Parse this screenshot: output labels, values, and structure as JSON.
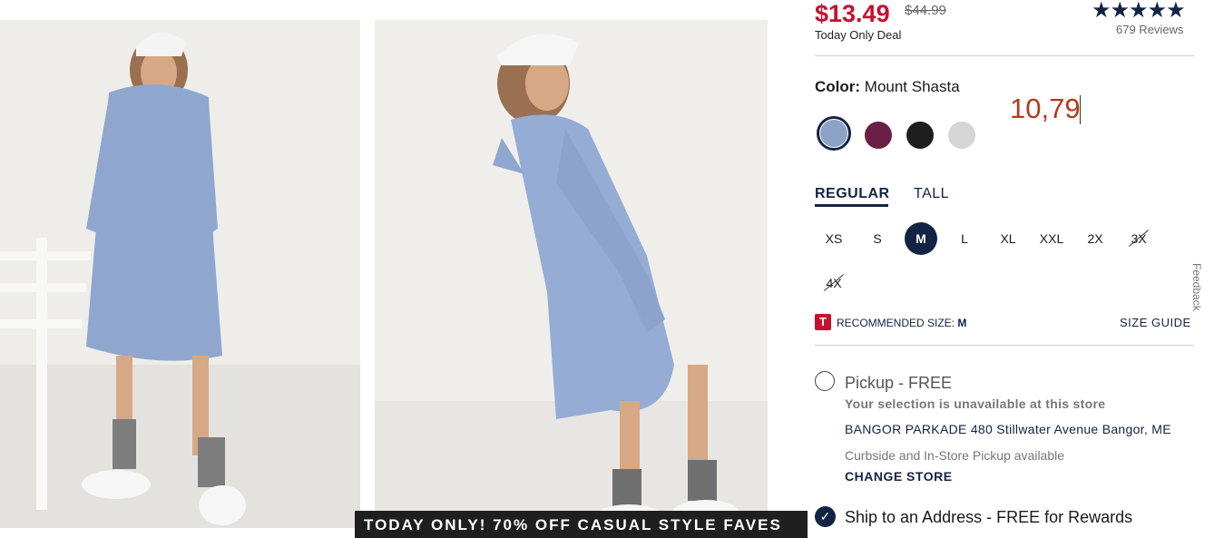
{
  "product": {
    "price": "$13.49",
    "original_price": "$44.99",
    "deal_label": "Today Only Deal",
    "rating_stars": "★★★★★",
    "rating_value": 4.5,
    "reviews": "679 Reviews"
  },
  "color": {
    "label": "Color:",
    "value": "Mount Shasta",
    "swatches": [
      {
        "name": "Mount Shasta",
        "hex": "#8da3c6",
        "selected": true
      },
      {
        "name": "Plum",
        "hex": "#6b1f45",
        "selected": false
      },
      {
        "name": "Black",
        "hex": "#1e1e1e",
        "selected": false
      },
      {
        "name": "Heather Gray",
        "hex": "#d5d5d5",
        "selected": false
      }
    ]
  },
  "overlay_text": "10,79",
  "fit_tabs": {
    "regular": "REGULAR",
    "tall": "TALL",
    "active": "REGULAR"
  },
  "sizes": [
    {
      "label": "XS",
      "state": "available"
    },
    {
      "label": "S",
      "state": "available"
    },
    {
      "label": "M",
      "state": "selected"
    },
    {
      "label": "L",
      "state": "available"
    },
    {
      "label": "XL",
      "state": "available"
    },
    {
      "label": "XXL",
      "state": "available"
    },
    {
      "label": "2X",
      "state": "available"
    },
    {
      "label": "3X",
      "state": "unavailable"
    },
    {
      "label": "4X",
      "state": "unavailable"
    }
  ],
  "recommendation": {
    "badge": "T",
    "label": "RECOMMENDED SIZE:",
    "size": "M",
    "size_guide": "SIZE GUIDE"
  },
  "fulfillment": {
    "pickup_title": "Pickup - FREE",
    "pickup_selected": false,
    "unavailable_note": "Your selection is unavailable at this store",
    "store_line": "BANGOR PARKADE 480 Stillwater Avenue  Bangor, ME",
    "curbside_note": "Curbside and In-Store Pickup available",
    "change_store": "CHANGE STORE",
    "ship_title": "Ship to an Address - FREE for Rewards",
    "ship_selected": true
  },
  "promo_banner": "TODAY ONLY! 70% OFF CASUAL STYLE FAVES",
  "feedback_tab": "Feedback",
  "colors": {
    "navy": "#122344",
    "sale_red": "#c8102e",
    "dress_blue": "#8fa7cf"
  }
}
